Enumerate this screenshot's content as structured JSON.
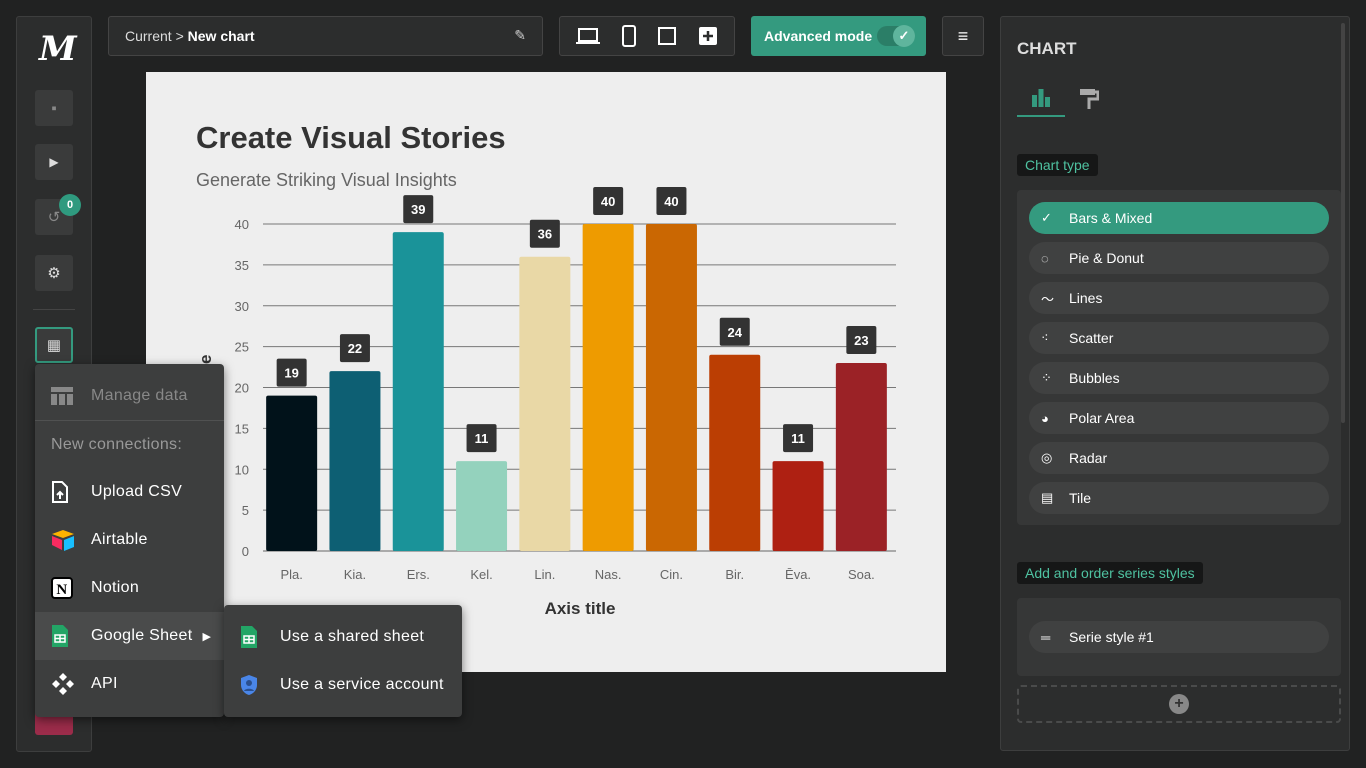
{
  "app": {
    "logo": "M"
  },
  "sidebar": {
    "undo_count": "0",
    "icons": [
      "save-icon",
      "play-icon",
      "undo-icon",
      "settings-icon",
      "table-icon"
    ]
  },
  "breadcrumb": {
    "parent": "Current >",
    "current": "New chart"
  },
  "toolbar": {
    "advanced_mode_label": "Advanced mode",
    "advanced_mode_on": true,
    "devices": [
      "laptop-icon",
      "phone-icon",
      "square-icon",
      "add-icon"
    ]
  },
  "data_menu": {
    "manage": "Manage data",
    "section": "New connections:",
    "items": [
      {
        "label": "Upload CSV",
        "icon": "upload-file-icon"
      },
      {
        "label": "Airtable",
        "icon": "airtable-icon"
      },
      {
        "label": "Notion",
        "icon": "notion-icon"
      },
      {
        "label": "Google Sheet",
        "icon": "google-sheets-icon"
      },
      {
        "label": "API",
        "icon": "api-icon"
      }
    ],
    "submenu": [
      {
        "label": "Use a shared sheet",
        "icon": "google-sheets-icon"
      },
      {
        "label": "Use a service account",
        "icon": "shield-user-icon"
      }
    ]
  },
  "panel": {
    "title": "CHART",
    "chart_type_label": "Chart type",
    "chart_types": [
      {
        "label": "Bars & Mixed",
        "icon": "check-icon",
        "selected": true
      },
      {
        "label": "Pie & Donut",
        "icon": "donut-icon"
      },
      {
        "label": "Lines",
        "icon": "line-icon"
      },
      {
        "label": "Scatter",
        "icon": "scatter-icon"
      },
      {
        "label": "Bubbles",
        "icon": "bubbles-icon"
      },
      {
        "label": "Polar Area",
        "icon": "polar-icon"
      },
      {
        "label": "Radar",
        "icon": "radar-icon"
      },
      {
        "label": "Tile",
        "icon": "tile-icon"
      }
    ],
    "series_label": "Add and order series styles",
    "series": [
      {
        "label": "Serie style #1"
      }
    ],
    "accent": "#349a7f"
  },
  "chart_data": {
    "type": "bar",
    "title": "Create Visual Stories",
    "subtitle": "Generate Striking Visual Insights",
    "xlabel": "Axis title",
    "ylabel": "Axis title",
    "categories": [
      "Pla.",
      "Kia.",
      "Ers.",
      "Kel.",
      "Lin.",
      "Nas.",
      "Cin.",
      "Bir.",
      "Ēva.",
      "Soa."
    ],
    "values": [
      19,
      22,
      39,
      11,
      36,
      40,
      40,
      24,
      11,
      23
    ],
    "colors": [
      "#01121a",
      "#0d5f73",
      "#1a9399",
      "#94d2bd",
      "#e9d8a6",
      "#ee9b00",
      "#ca6702",
      "#bb3e03",
      "#ae2012",
      "#9b2226"
    ],
    "ylim": [
      0,
      40
    ],
    "yticks": [
      0,
      5,
      10,
      15,
      20,
      25,
      30,
      35,
      40
    ],
    "grid": true,
    "data_labels": true
  }
}
